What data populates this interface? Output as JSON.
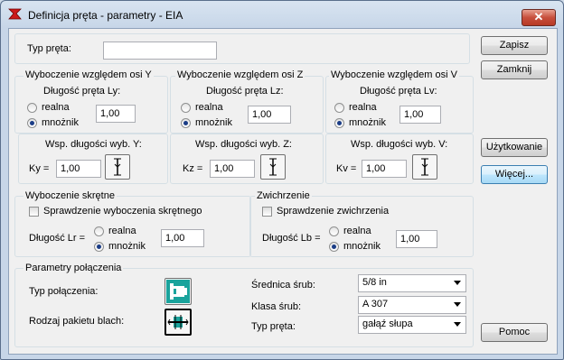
{
  "window": {
    "title": "Definicja pręta - parametry - EIA",
    "close": "✕"
  },
  "typ_preta": {
    "label": "Typ pręta:",
    "value": ""
  },
  "buttons": {
    "zapisz": "Zapisz",
    "zamknij": "Zamknij",
    "uzytkowanie": "Użytkowanie",
    "wiecej": "Więcej...",
    "pomoc": "Pomoc"
  },
  "buckling": [
    {
      "title": "Wyboczenie względem osi Y",
      "length_label": "Długość pręta Ly:",
      "real": "realna",
      "factor": "mnożnik",
      "value": "1,00",
      "coef_label": "Wsp. długości wyb. Y:",
      "coef_prefix": "Ky =",
      "coef_value": "1,00"
    },
    {
      "title": "Wyboczenie względem osi  Z",
      "length_label": "Długość pręta Lz:",
      "real": "realna",
      "factor": "mnożnik",
      "value": "1,00",
      "coef_label": "Wsp. długości wyb. Z:",
      "coef_prefix": "Kz =",
      "coef_value": "1,00"
    },
    {
      "title": "Wyboczenie względem osi V",
      "length_label": "Długość pręta Lv:",
      "real": "realna",
      "factor": "mnożnik",
      "value": "1,00",
      "coef_label": "Wsp. długości wyb. V:",
      "coef_prefix": "Kv =",
      "coef_value": "1,00"
    }
  ],
  "torsional": {
    "title": "Wyboczenie skrętne",
    "check": "Sprawdzenie wyboczenia skrętnego",
    "length_label": "Długość Lr =",
    "real": "realna",
    "factor": "mnożnik",
    "value": "1,00"
  },
  "lateral": {
    "title": "Zwichrzenie",
    "check": "Sprawdzenie zwichrzenia",
    "length_label": "Długość Lb =",
    "real": "realna",
    "factor": "mnożnik",
    "value": "1,00"
  },
  "connection": {
    "title": "Parametry połączenia",
    "type_label": "Typ połączenia:",
    "plates_label": "Rodzaj pakietu blach:",
    "bolt_diameter_label": "Średnica śrub:",
    "bolt_diameter_value": "5/8 in",
    "bolt_class_label": "Klasa śrub:",
    "bolt_class_value": "A 307",
    "member_type_label": "Typ pręta:",
    "member_type_value": "gałąź słupa"
  }
}
